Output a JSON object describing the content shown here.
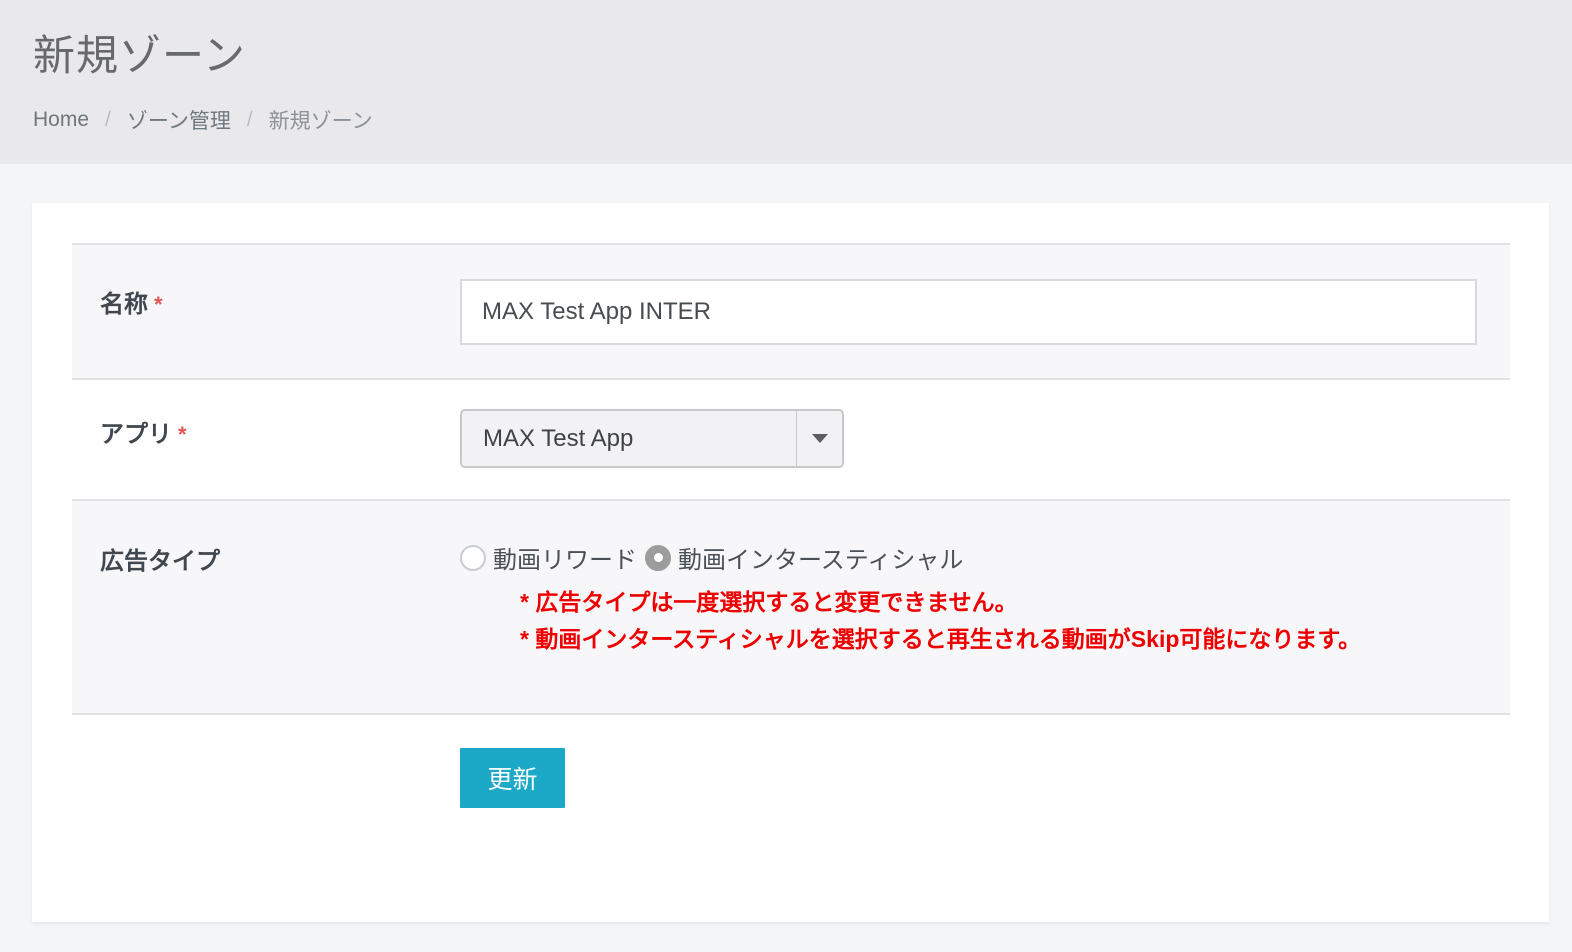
{
  "header": {
    "title": "新規ゾーン",
    "separator": "/",
    "breadcrumb": [
      "Home",
      "ゾーン管理",
      "新規ゾーン"
    ]
  },
  "form": {
    "required_marker": "*",
    "name": {
      "label": "名称",
      "value": "MAX Test App INTER"
    },
    "app": {
      "label": "アプリ",
      "selected": "MAX Test App"
    },
    "ad_type": {
      "label": "広告タイプ",
      "options": [
        {
          "label": "動画リワード",
          "checked": false
        },
        {
          "label": "動画インタースティシャル",
          "checked": true
        }
      ],
      "notes": [
        "* 広告タイプは一度選択すると変更できません。",
        "* 動画インタースティシャルを選択すると再生される動画がSkip可能になります。"
      ]
    },
    "submit_label": "更新"
  },
  "colors": {
    "header_bg": "#e9e9eb",
    "page_bg": "#f4f5f7",
    "row_shaded_bg": "#f7f7f9",
    "row_border": "#e2e2e4",
    "required_red": "#e25555",
    "note_red": "#ee0000",
    "button_teal": "#1ba9c7",
    "radio_checked_gray": "#9c9c9c"
  }
}
